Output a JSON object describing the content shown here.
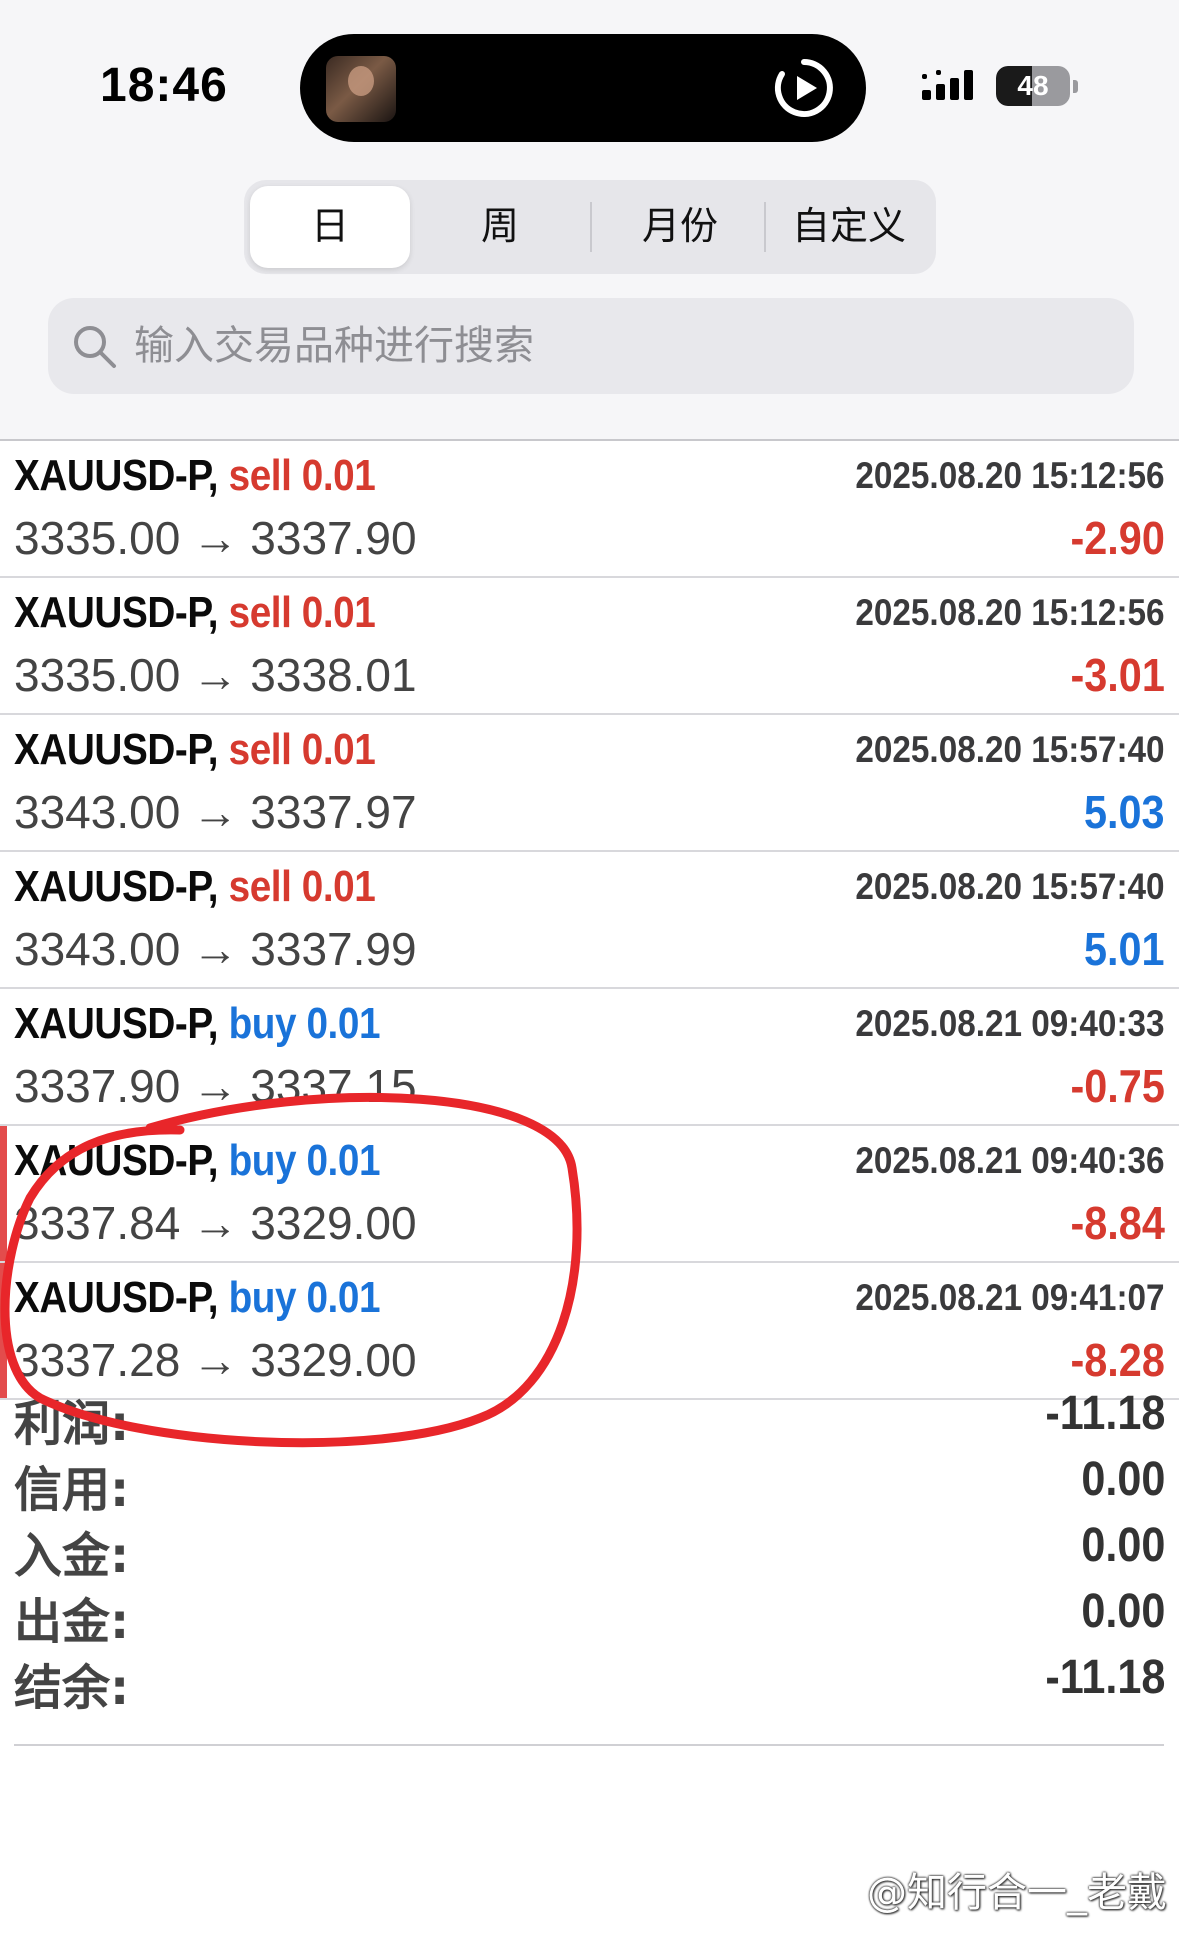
{
  "status_bar": {
    "time": "18:46",
    "battery_level": "48",
    "battery_percent": 48
  },
  "tabs": {
    "items": [
      {
        "label": "日",
        "active": true
      },
      {
        "label": "周",
        "active": false
      },
      {
        "label": "月份",
        "active": false
      },
      {
        "label": "自定义",
        "active": false
      }
    ]
  },
  "search": {
    "placeholder": "输入交易品种进行搜索",
    "icon": "search-icon"
  },
  "trades": [
    {
      "symbol": "XAUUSD-P,",
      "side": "sell",
      "volume": "0.01",
      "time": "2025.08.20 15:12:56",
      "open_price": "3335.00",
      "close_price": "3337.90",
      "profit": "-2.90"
    },
    {
      "symbol": "XAUUSD-P,",
      "side": "sell",
      "volume": "0.01",
      "time": "2025.08.20 15:12:56",
      "open_price": "3335.00",
      "close_price": "3338.01",
      "profit": "-3.01"
    },
    {
      "symbol": "XAUUSD-P,",
      "side": "sell",
      "volume": "0.01",
      "time": "2025.08.20 15:57:40",
      "open_price": "3343.00",
      "close_price": "3337.97",
      "profit": "5.03"
    },
    {
      "symbol": "XAUUSD-P,",
      "side": "sell",
      "volume": "0.01",
      "time": "2025.08.20 15:57:40",
      "open_price": "3343.00",
      "close_price": "3337.99",
      "profit": "5.01"
    },
    {
      "symbol": "XAUUSD-P,",
      "side": "buy",
      "volume": "0.01",
      "time": "2025.08.21 09:40:33",
      "open_price": "3337.90",
      "close_price": "3337.15",
      "profit": "-0.75"
    },
    {
      "symbol": "XAUUSD-P,",
      "side": "buy",
      "volume": "0.01",
      "time": "2025.08.21 09:40:36",
      "open_price": "3337.84",
      "close_price": "3329.00",
      "profit": "-8.84"
    },
    {
      "symbol": "XAUUSD-P,",
      "side": "buy",
      "volume": "0.01",
      "time": "2025.08.21 09:41:07",
      "open_price": "3337.28",
      "close_price": "3329.00",
      "profit": "-8.28"
    }
  ],
  "arrow_glyph": "→",
  "summary": {
    "profit_label": "利润:",
    "profit_value": "-11.18",
    "credit_label": "信用:",
    "credit_value": "0.00",
    "deposit_label": "入金:",
    "deposit_value": "0.00",
    "withdrawal_label": "出金:",
    "withdrawal_value": "0.00",
    "balance_label": "结余:",
    "balance_value": "-11.18"
  },
  "watermark": "@知行合一_老戴",
  "colors": {
    "loss": "#d63a2f",
    "gain": "#1a73d9",
    "sell": "#d63a2f",
    "buy": "#1a73d9",
    "annotation": "#e8262a"
  }
}
